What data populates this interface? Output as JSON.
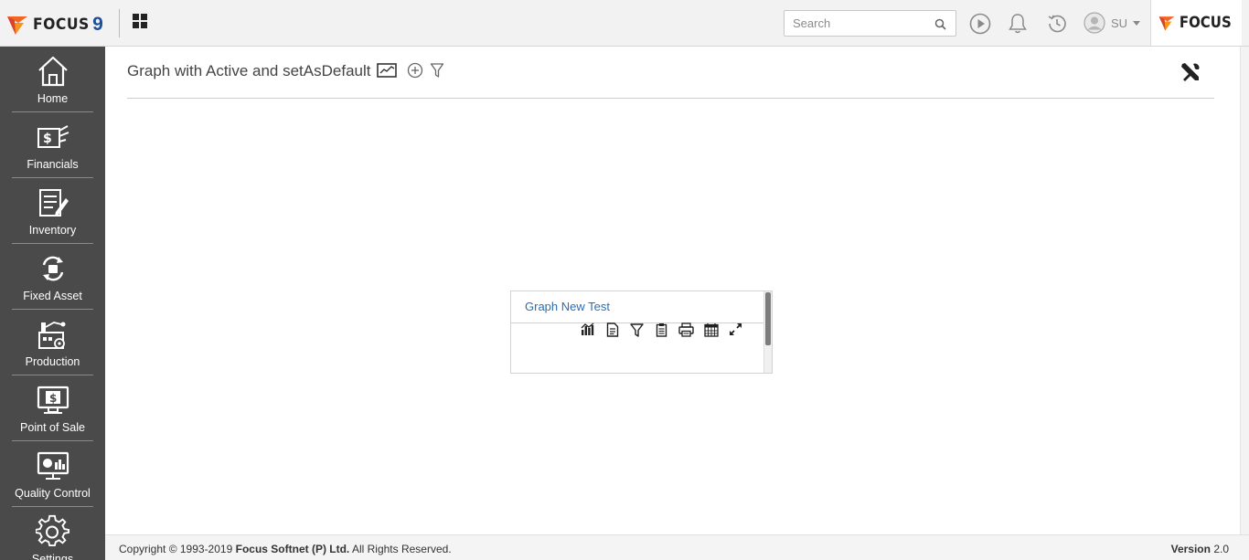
{
  "topbar": {
    "logo_text": "FOCUS",
    "logo_number": "9",
    "search": {
      "placeholder": "Search",
      "value": ""
    },
    "user_label": "SU",
    "brand_text": "FOCUS"
  },
  "sidebar": {
    "items": [
      {
        "label": "Home",
        "icon": "home-icon"
      },
      {
        "label": "Financials",
        "icon": "financials-icon"
      },
      {
        "label": "Inventory",
        "icon": "inventory-icon"
      },
      {
        "label": "Fixed Asset",
        "icon": "fixed-asset-icon"
      },
      {
        "label": "Production",
        "icon": "production-icon"
      },
      {
        "label": "Point of Sale",
        "icon": "point-of-sale-icon"
      },
      {
        "label": "Quality Control",
        "icon": "quality-control-icon"
      },
      {
        "label": "Settings",
        "icon": "gear-icon"
      }
    ]
  },
  "page": {
    "title": "Graph with Active and setAsDefault"
  },
  "widget": {
    "title": "Graph New Test",
    "tools": [
      "chart-type-icon",
      "document-icon",
      "filter-icon",
      "clipboard-icon",
      "print-icon",
      "calendar-icon",
      "expand-icon"
    ]
  },
  "footer": {
    "copyright_prefix": "Copyright © 1993-2019",
    "company": "Focus Softnet (P) Ltd.",
    "rights": "All Rights Reserved.",
    "version_label": "Version",
    "version_number": "2.0"
  },
  "colors": {
    "sidebar_bg": "#4a4a4a",
    "topbar_bg": "#f2f2f2",
    "link_blue": "#2a6eb0",
    "logo_orange": "#f26522"
  }
}
